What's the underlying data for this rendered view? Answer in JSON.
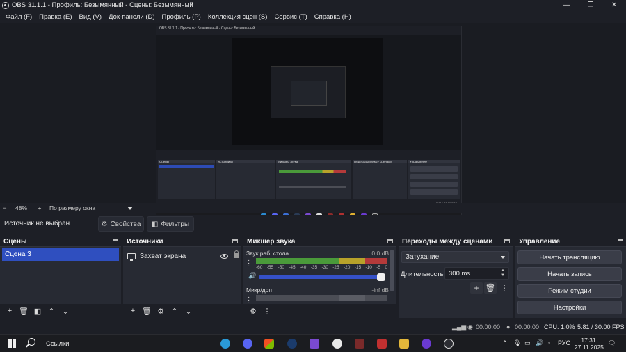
{
  "window": {
    "title": "OBS 31.1.1 - Профиль: Безымянный - Сцены: Безымянный",
    "minimize": "—",
    "maximize": "❐",
    "close": "✕"
  },
  "menu": [
    "Файл (F)",
    "Правка (E)",
    "Вид (V)",
    "Док-панели (D)",
    "Профиль (P)",
    "Коллекция сцен (S)",
    "Сервис (T)",
    "Справка (H)"
  ],
  "preview_zoom": {
    "zoom_out": "−",
    "value": "48%",
    "zoom_in": "+",
    "fit_mode": "По размеру окна"
  },
  "source_toolbar": {
    "no_source": "Источник не выбран",
    "properties": "Свойства",
    "filters": "Фильтры"
  },
  "scenes": {
    "title": "Сцены",
    "items": [
      "Сцена 3"
    ]
  },
  "sources": {
    "title": "Источники",
    "items": [
      "Захват экрана"
    ]
  },
  "mixer": {
    "title": "Микшер звука",
    "channels": [
      {
        "name": "Звук раб. стола",
        "db": "0.0 dB",
        "level": 1.0
      },
      {
        "name": "Микр/доп",
        "db": "-inf dB",
        "level": 0.0
      }
    ],
    "ticks": [
      "-60",
      "-55",
      "-50",
      "-45",
      "-40",
      "-35",
      "-30",
      "-25",
      "-20",
      "-15",
      "-10",
      "-5",
      "0"
    ]
  },
  "transitions": {
    "title": "Переходы между сценами",
    "selected": "Затухание",
    "duration_label": "Длительность",
    "duration_value": "300 ms"
  },
  "controls": {
    "title": "Управление",
    "start_stream": "Начать трансляцию",
    "start_record": "Начать запись",
    "studio_mode": "Режим студии",
    "settings": "Настройки"
  },
  "status": {
    "stream_time": "00:00:00",
    "record_time": "00:00:00",
    "cpu": "CPU: 1.0%",
    "fps": "5.81 / 30.00 FPS"
  },
  "taskbar": {
    "search_label": "Ссылки",
    "lang": "РУС",
    "time": "17:31",
    "date": "27.11.2025"
  },
  "colors": {
    "accent": "#2f4fbf",
    "meter_green": "#4a9a3a",
    "meter_yellow": "#b8a22a",
    "meter_red": "#b43a3a",
    "panel": "#272a33",
    "background": "#1d1f26"
  }
}
